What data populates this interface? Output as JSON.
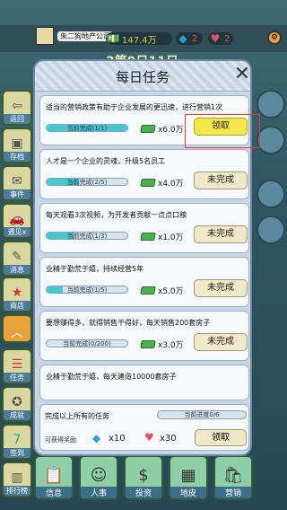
{
  "company": {
    "name": "朱二狗地产公司"
  },
  "stats": {
    "money": "147.4万",
    "gems": "2",
    "hearts": "2"
  },
  "background_text": "3第9日11日",
  "side_icons": [
    {
      "label": "返回",
      "icon": "back-icon"
    },
    {
      "label": "存档",
      "icon": "save-icon"
    },
    {
      "label": "事件",
      "icon": "event-icon"
    },
    {
      "label": "遇见x",
      "icon": "car-icon"
    },
    {
      "label": "消息",
      "icon": "message-icon"
    },
    {
      "label": "商店",
      "icon": "shop-icon"
    },
    {
      "label": "",
      "icon": "chevron-up-icon"
    },
    {
      "label": "任务",
      "icon": "tasks-icon"
    },
    {
      "label": "成就",
      "icon": "achievement-icon"
    },
    {
      "label": "签到",
      "icon": "calendar-icon"
    },
    {
      "label": "排行榜",
      "icon": "ranking-icon"
    }
  ],
  "bottom_nav": [
    {
      "label": "信息",
      "icon": "info-icon"
    },
    {
      "label": "人事",
      "icon": "staff-icon"
    },
    {
      "label": "投资",
      "icon": "invest-icon"
    },
    {
      "label": "地皮",
      "icon": "building-icon"
    },
    {
      "label": "营销",
      "icon": "marketing-icon"
    }
  ],
  "modal": {
    "title": "每日任务",
    "tasks": [
      {
        "desc": "适当的营销政策有助于企业发展的更迅速，进行营销1次",
        "progress_text": "当前完成(1/1)",
        "progress": 1.0,
        "reward": "x6.0万",
        "button": "领取",
        "state": "claim"
      },
      {
        "desc": "人才是一个企业的灵魂，升级5名员工",
        "progress_text": "当前完成(2/5)",
        "progress": 0.4,
        "reward": "x4.0万",
        "button": "未完成",
        "state": "pending"
      },
      {
        "desc": "每天观看3次视频，为开发者贡献一点点口粮",
        "progress_text": "当前完成(1/3)",
        "progress": 0.333,
        "reward": "x1.0万",
        "button": "未完成",
        "state": "pending"
      },
      {
        "desc": "业精于勤荒于嬉，持续经营5年",
        "progress_text": "当前完成(1/5)",
        "progress": 0.2,
        "reward": "x5.0万",
        "button": "未完成",
        "state": "pending"
      },
      {
        "desc": "要想赚得多，就得销售干得好，每天销售200套房子",
        "progress_text": "当前完成(0/200)",
        "progress": 0.0,
        "reward": "x3.0万",
        "button": "未完成",
        "state": "pending"
      },
      {
        "desc": "业精于勤荒于嬉，每天建造10000套房子",
        "progress_text": "",
        "progress": 0.0,
        "reward": "",
        "button": "",
        "state": "pending"
      }
    ],
    "all_tasks": {
      "label": "完成以上所有的任务",
      "progress_text": "当前进度0/6",
      "reward_label": "可获得奖励",
      "gems": "x10",
      "hearts": "x30",
      "button": "领取"
    }
  }
}
